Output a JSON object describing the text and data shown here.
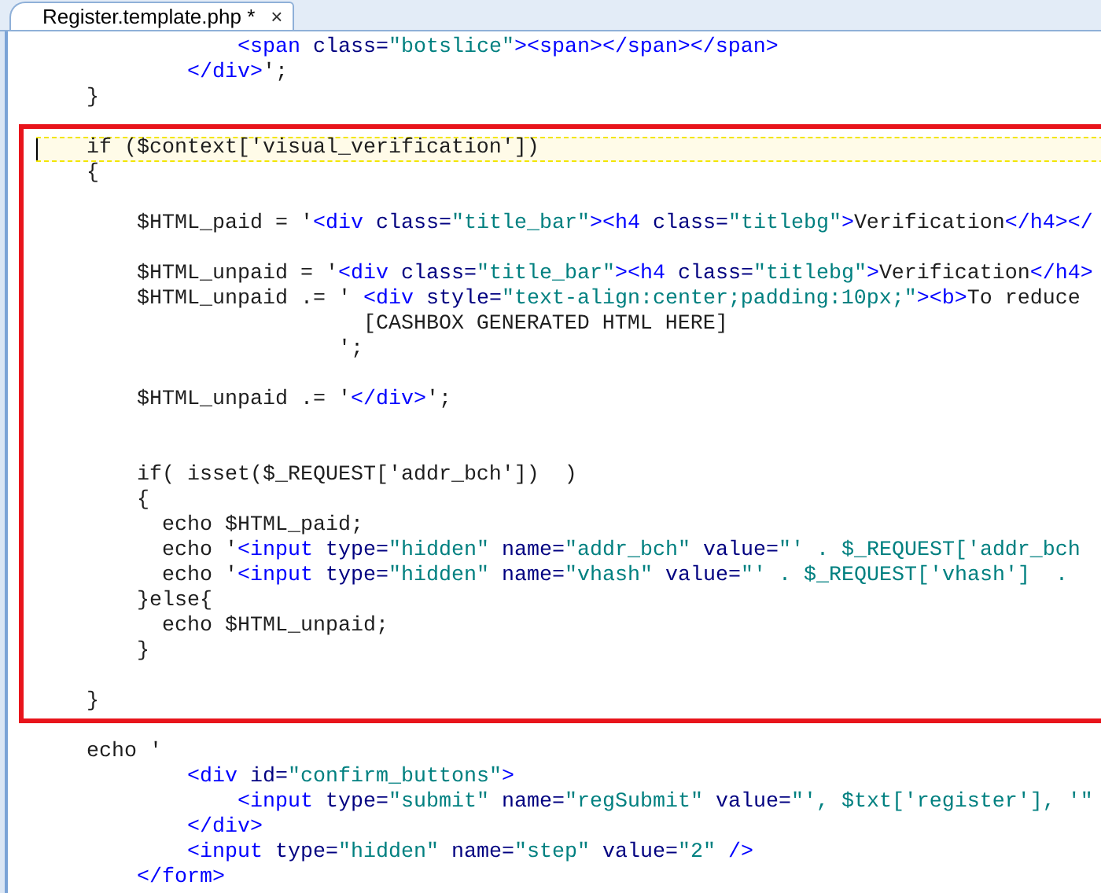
{
  "tabs": [
    {
      "label": "Register.template.php *",
      "close": "×",
      "selected": true
    }
  ],
  "sections": [
    {
      "boxed": false,
      "lines": [
        {
          "kind": "code",
          "current": false,
          "tokens": [
            {
              "kind": "tag",
              "text": "                <span"
            },
            {
              "kind": "attr",
              "text": " class="
            },
            {
              "kind": "value",
              "text": "\"botslice\""
            },
            {
              "kind": "tag",
              "text": "><span></span></span>"
            }
          ]
        },
        {
          "kind": "code",
          "current": false,
          "tokens": [
            {
              "kind": "tag",
              "text": "            </div>"
            },
            {
              "kind": "plain",
              "text": "';"
            }
          ]
        },
        {
          "kind": "code",
          "current": false,
          "tokens": [
            {
              "kind": "plain",
              "text": "    }"
            }
          ]
        }
      ]
    },
    {
      "boxed": true,
      "lines": [
        {
          "kind": "code",
          "current": true,
          "tokens": [
            {
              "kind": "plain",
              "text": "    if ($context['visual_verification'])"
            }
          ]
        },
        {
          "kind": "code",
          "current": false,
          "tokens": [
            {
              "kind": "plain",
              "text": "    {"
            }
          ]
        },
        {
          "kind": "blank"
        },
        {
          "kind": "code",
          "current": false,
          "tokens": [
            {
              "kind": "plain",
              "text": "        $HTML_paid = '"
            },
            {
              "kind": "tag",
              "text": "<div"
            },
            {
              "kind": "attr",
              "text": " class="
            },
            {
              "kind": "value",
              "text": "\"title_bar\""
            },
            {
              "kind": "tag",
              "text": "><h4"
            },
            {
              "kind": "attr",
              "text": " class="
            },
            {
              "kind": "value",
              "text": "\"titlebg\""
            },
            {
              "kind": "tag",
              "text": ">"
            },
            {
              "kind": "plain",
              "text": "Verification"
            },
            {
              "kind": "tag",
              "text": "</h4></"
            }
          ]
        },
        {
          "kind": "blank"
        },
        {
          "kind": "code",
          "current": false,
          "tokens": [
            {
              "kind": "plain",
              "text": "        $HTML_unpaid = '"
            },
            {
              "kind": "tag",
              "text": "<div"
            },
            {
              "kind": "attr",
              "text": " class="
            },
            {
              "kind": "value",
              "text": "\"title_bar\""
            },
            {
              "kind": "tag",
              "text": "><h4"
            },
            {
              "kind": "attr",
              "text": " class="
            },
            {
              "kind": "value",
              "text": "\"titlebg\""
            },
            {
              "kind": "tag",
              "text": ">"
            },
            {
              "kind": "plain",
              "text": "Verification"
            },
            {
              "kind": "tag",
              "text": "</h4>"
            }
          ]
        },
        {
          "kind": "code",
          "current": false,
          "tokens": [
            {
              "kind": "plain",
              "text": "        $HTML_unpaid .= '"
            },
            {
              "kind": "tag",
              "text": " <div"
            },
            {
              "kind": "attr",
              "text": " style="
            },
            {
              "kind": "value",
              "text": "\"text-align:center;padding:10px;\""
            },
            {
              "kind": "tag",
              "text": "><b>"
            },
            {
              "kind": "plain",
              "text": "To reduce"
            }
          ]
        },
        {
          "kind": "code",
          "current": false,
          "tokens": [
            {
              "kind": "plain",
              "text": "                          [CASHBOX GENERATED HTML HERE]"
            }
          ]
        },
        {
          "kind": "code",
          "current": false,
          "tokens": [
            {
              "kind": "plain",
              "text": "                        ';"
            }
          ]
        },
        {
          "kind": "blank"
        },
        {
          "kind": "code",
          "current": false,
          "tokens": [
            {
              "kind": "plain",
              "text": "        $HTML_unpaid .= '"
            },
            {
              "kind": "tag",
              "text": "</div>"
            },
            {
              "kind": "plain",
              "text": "';"
            }
          ]
        },
        {
          "kind": "blank"
        },
        {
          "kind": "blank"
        },
        {
          "kind": "code",
          "current": false,
          "tokens": [
            {
              "kind": "plain",
              "text": "        if( isset($_REQUEST['addr_bch'])  )"
            }
          ]
        },
        {
          "kind": "code",
          "current": false,
          "tokens": [
            {
              "kind": "plain",
              "text": "        {"
            }
          ]
        },
        {
          "kind": "code",
          "current": false,
          "tokens": [
            {
              "kind": "plain",
              "text": "          echo $HTML_paid;"
            }
          ]
        },
        {
          "kind": "code",
          "current": false,
          "tokens": [
            {
              "kind": "plain",
              "text": "          echo '"
            },
            {
              "kind": "tag",
              "text": "<input"
            },
            {
              "kind": "attr",
              "text": " type="
            },
            {
              "kind": "value",
              "text": "\"hidden\""
            },
            {
              "kind": "attr",
              "text": " name="
            },
            {
              "kind": "value",
              "text": "\"addr_bch\""
            },
            {
              "kind": "attr",
              "text": " value="
            },
            {
              "kind": "value",
              "text": "\"' . $_REQUEST['addr_bch"
            }
          ]
        },
        {
          "kind": "code",
          "current": false,
          "tokens": [
            {
              "kind": "plain",
              "text": "          echo '"
            },
            {
              "kind": "tag",
              "text": "<input"
            },
            {
              "kind": "attr",
              "text": " type="
            },
            {
              "kind": "value",
              "text": "\"hidden\""
            },
            {
              "kind": "attr",
              "text": " name="
            },
            {
              "kind": "value",
              "text": "\"vhash\""
            },
            {
              "kind": "attr",
              "text": " value="
            },
            {
              "kind": "value",
              "text": "\"' . $_REQUEST['vhash']  ."
            }
          ]
        },
        {
          "kind": "code",
          "current": false,
          "tokens": [
            {
              "kind": "plain",
              "text": "        }else{"
            }
          ]
        },
        {
          "kind": "code",
          "current": false,
          "tokens": [
            {
              "kind": "plain",
              "text": "          echo $HTML_unpaid;"
            }
          ]
        },
        {
          "kind": "code",
          "current": false,
          "tokens": [
            {
              "kind": "plain",
              "text": "        }"
            }
          ]
        },
        {
          "kind": "blank"
        },
        {
          "kind": "code",
          "current": false,
          "tokens": [
            {
              "kind": "plain",
              "text": "    }"
            }
          ]
        }
      ]
    },
    {
      "boxed": false,
      "lines": [
        {
          "kind": "code",
          "current": false,
          "tokens": [
            {
              "kind": "plain",
              "text": "    echo '"
            }
          ]
        },
        {
          "kind": "code",
          "current": false,
          "tokens": [
            {
              "kind": "tag",
              "text": "            <div"
            },
            {
              "kind": "attr",
              "text": " id="
            },
            {
              "kind": "value",
              "text": "\"confirm_buttons\""
            },
            {
              "kind": "tag",
              "text": ">"
            }
          ]
        },
        {
          "kind": "code",
          "current": false,
          "tokens": [
            {
              "kind": "tag",
              "text": "                <input"
            },
            {
              "kind": "attr",
              "text": " type="
            },
            {
              "kind": "value",
              "text": "\"submit\""
            },
            {
              "kind": "attr",
              "text": " name="
            },
            {
              "kind": "value",
              "text": "\"regSubmit\""
            },
            {
              "kind": "attr",
              "text": " value="
            },
            {
              "kind": "value",
              "text": "\"', $txt['register'], '\""
            }
          ]
        },
        {
          "kind": "code",
          "current": false,
          "tokens": [
            {
              "kind": "tag",
              "text": "            </div>"
            }
          ]
        },
        {
          "kind": "code",
          "current": false,
          "tokens": [
            {
              "kind": "tag",
              "text": "            <input"
            },
            {
              "kind": "attr",
              "text": " type="
            },
            {
              "kind": "value",
              "text": "\"hidden\""
            },
            {
              "kind": "attr",
              "text": " name="
            },
            {
              "kind": "value",
              "text": "\"step\""
            },
            {
              "kind": "attr",
              "text": " value="
            },
            {
              "kind": "value",
              "text": "\"2\""
            },
            {
              "kind": "tag",
              "text": " />"
            }
          ]
        },
        {
          "kind": "code",
          "current": false,
          "tokens": [
            {
              "kind": "tag",
              "text": "        </form>"
            }
          ]
        }
      ]
    }
  ]
}
